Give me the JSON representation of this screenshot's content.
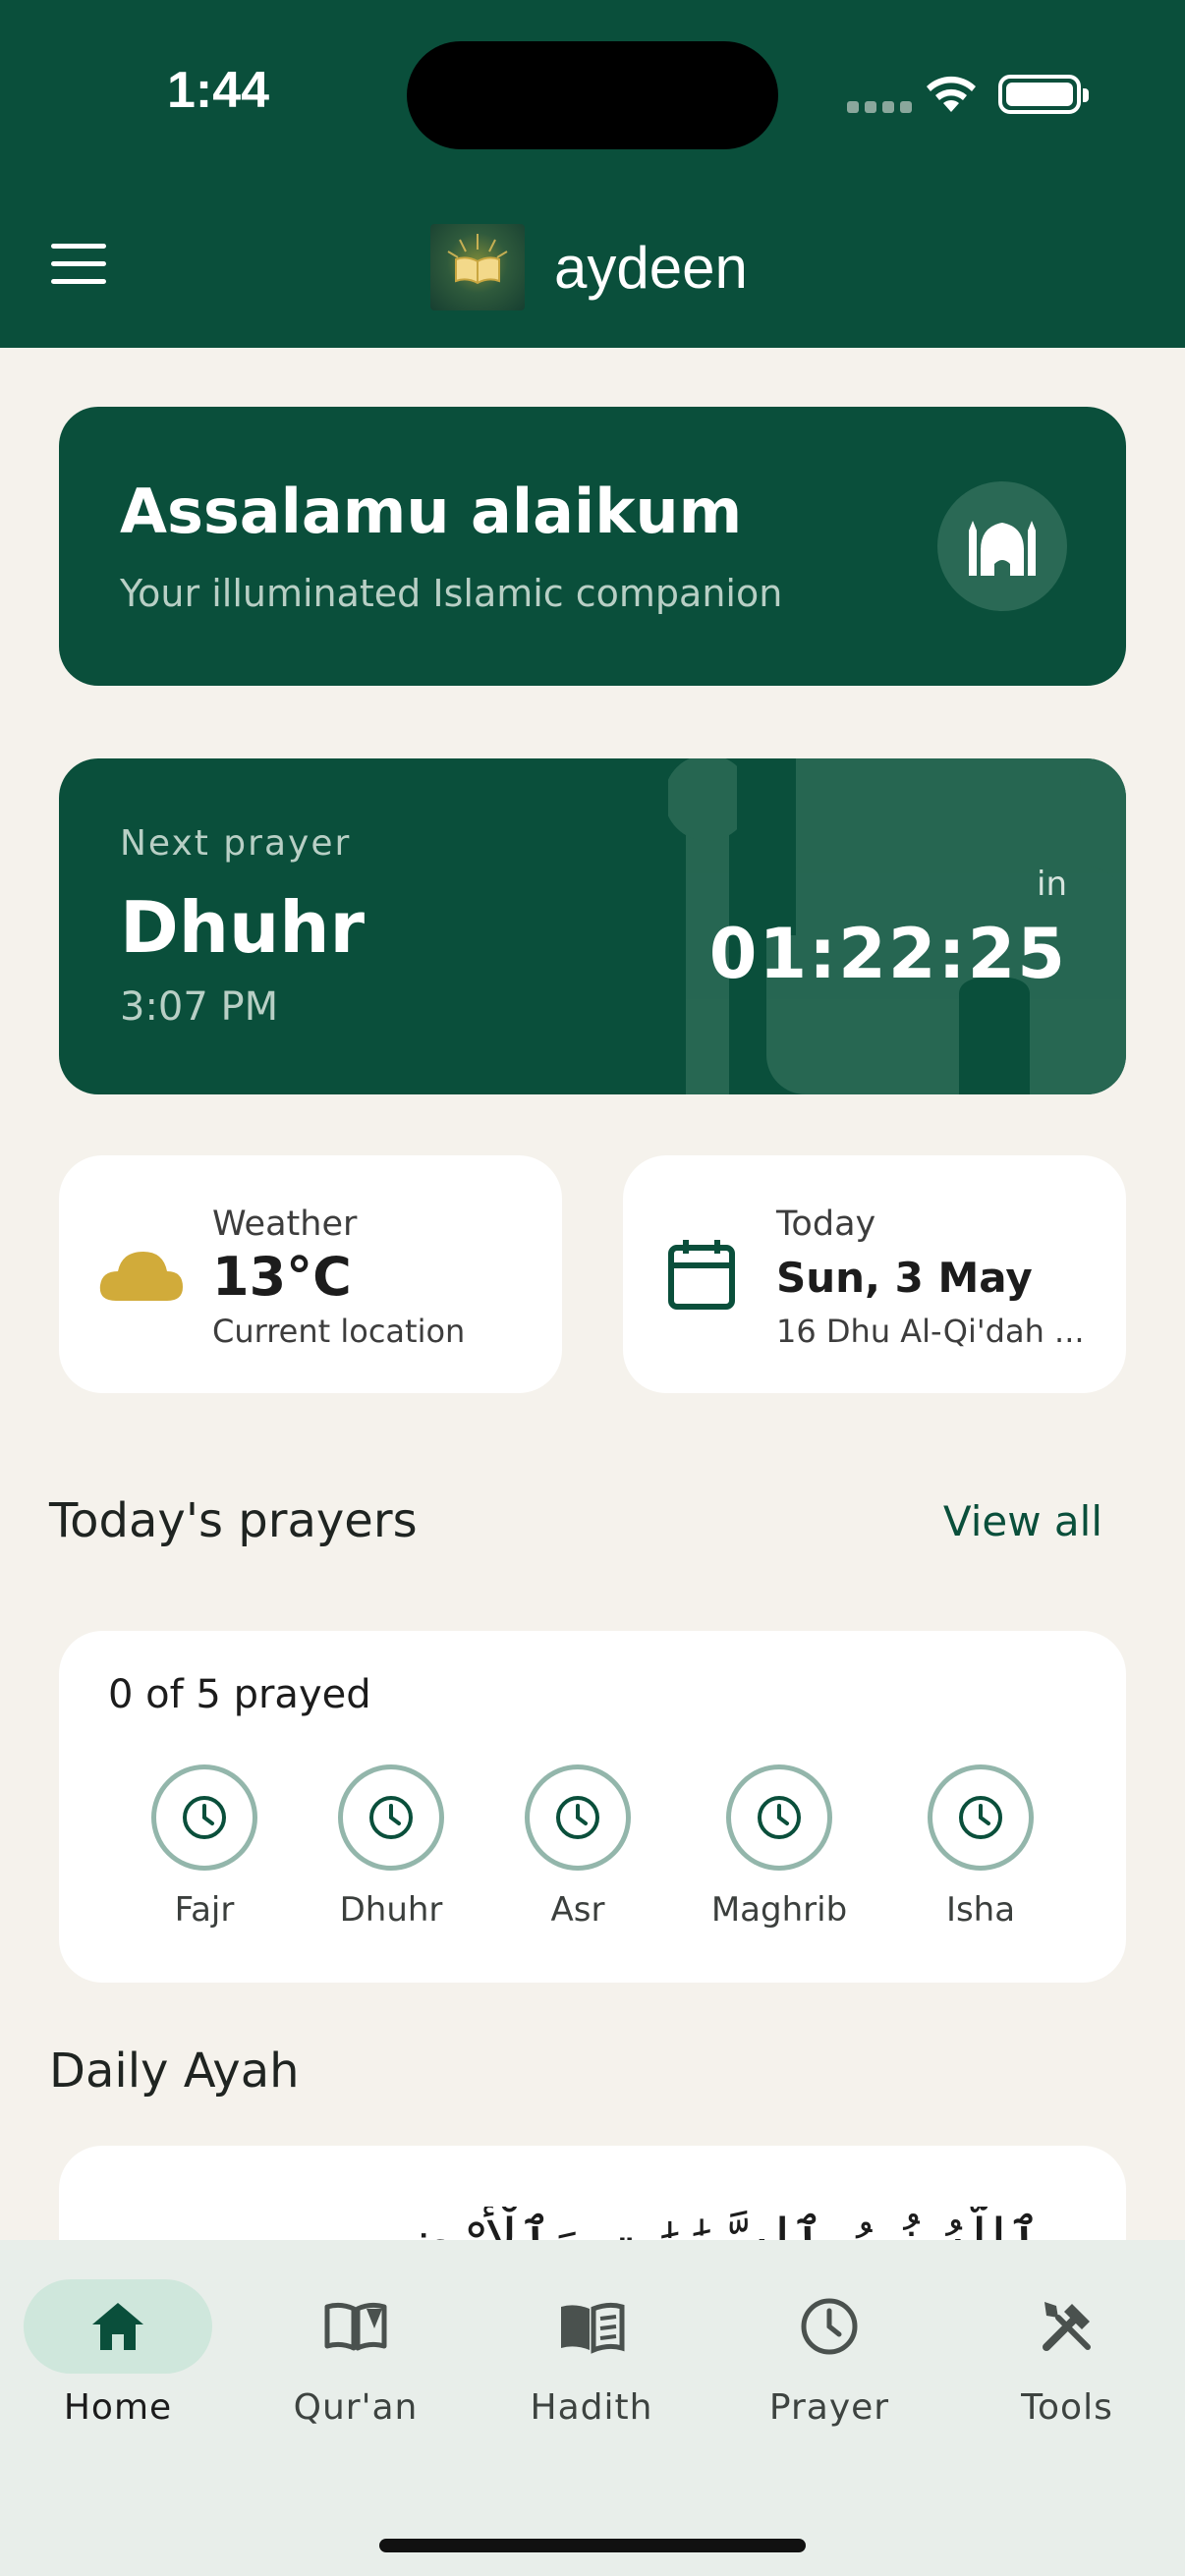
{
  "status_bar": {
    "time": "1:44"
  },
  "header": {
    "app_title": "aydeen",
    "icons": [
      "menu-icon",
      "quran-logo"
    ]
  },
  "greeting": {
    "title": "Assalamu alaikum",
    "subtitle": "Your illuminated Islamic companion",
    "icon": "mosque-icon"
  },
  "next_prayer": {
    "label": "Next prayer",
    "name": "Dhuhr",
    "time": "3:07 PM",
    "in_label": "in",
    "countdown": "01:22:25"
  },
  "weather": {
    "label": "Weather",
    "value": "13°C",
    "sub": "Current location",
    "icon": "cloud-icon"
  },
  "date": {
    "label": "Today",
    "value": "Sun, 3 May",
    "sub": "16 Dhu Al-Qi'dah ...",
    "icon": "calendar-icon"
  },
  "prayers_section": {
    "title": "Today's prayers",
    "view_all": "View all",
    "count_text": "0 of 5 prayed",
    "prayers": [
      {
        "name": "Fajr"
      },
      {
        "name": "Dhuhr"
      },
      {
        "name": "Asr"
      },
      {
        "name": "Maghrib"
      },
      {
        "name": "Isha"
      }
    ]
  },
  "ayah_section": {
    "title": "Daily Ayah",
    "text": "ٱللَّهُ نُورُ ٱلسَّمَٰوَٰتِ وَٱلْأَرْضِ"
  },
  "bottom_nav": {
    "items": [
      {
        "label": "Home",
        "icon": "home-icon",
        "active": true
      },
      {
        "label": "Qur'an",
        "icon": "open-book-icon",
        "active": false
      },
      {
        "label": "Hadith",
        "icon": "book-icon",
        "active": false
      },
      {
        "label": "Prayer",
        "icon": "clock-icon",
        "active": false
      },
      {
        "label": "Tools",
        "icon": "tools-icon",
        "active": false
      }
    ]
  },
  "colors": {
    "primary": "#0a4f3b",
    "background": "#f5f2ec",
    "accent_gold": "#d1ab3a",
    "nav_active": "#cfe7dc"
  }
}
